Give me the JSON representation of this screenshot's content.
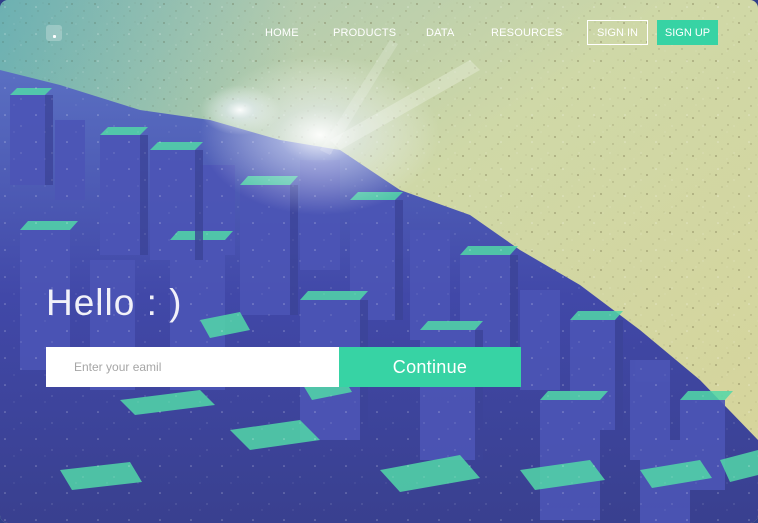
{
  "nav": {
    "logo_icon": "square-dot-logo-icon",
    "links": [
      {
        "label": "HOME"
      },
      {
        "label": "PRODUCTS"
      },
      {
        "label": "DATA"
      },
      {
        "label": "RESOURCES"
      }
    ],
    "sign_in_label": "SIGN IN",
    "sign_up_label": "SIGN UP"
  },
  "hero": {
    "greeting": "Hello : )",
    "email_placeholder": "Enter your eamil",
    "continue_label": "Continue"
  },
  "colors": {
    "accent": "#37d3a4",
    "sky_top": "#cfd6a0",
    "city_blue": "#3b44a3",
    "city_green": "#4fd7a3"
  }
}
